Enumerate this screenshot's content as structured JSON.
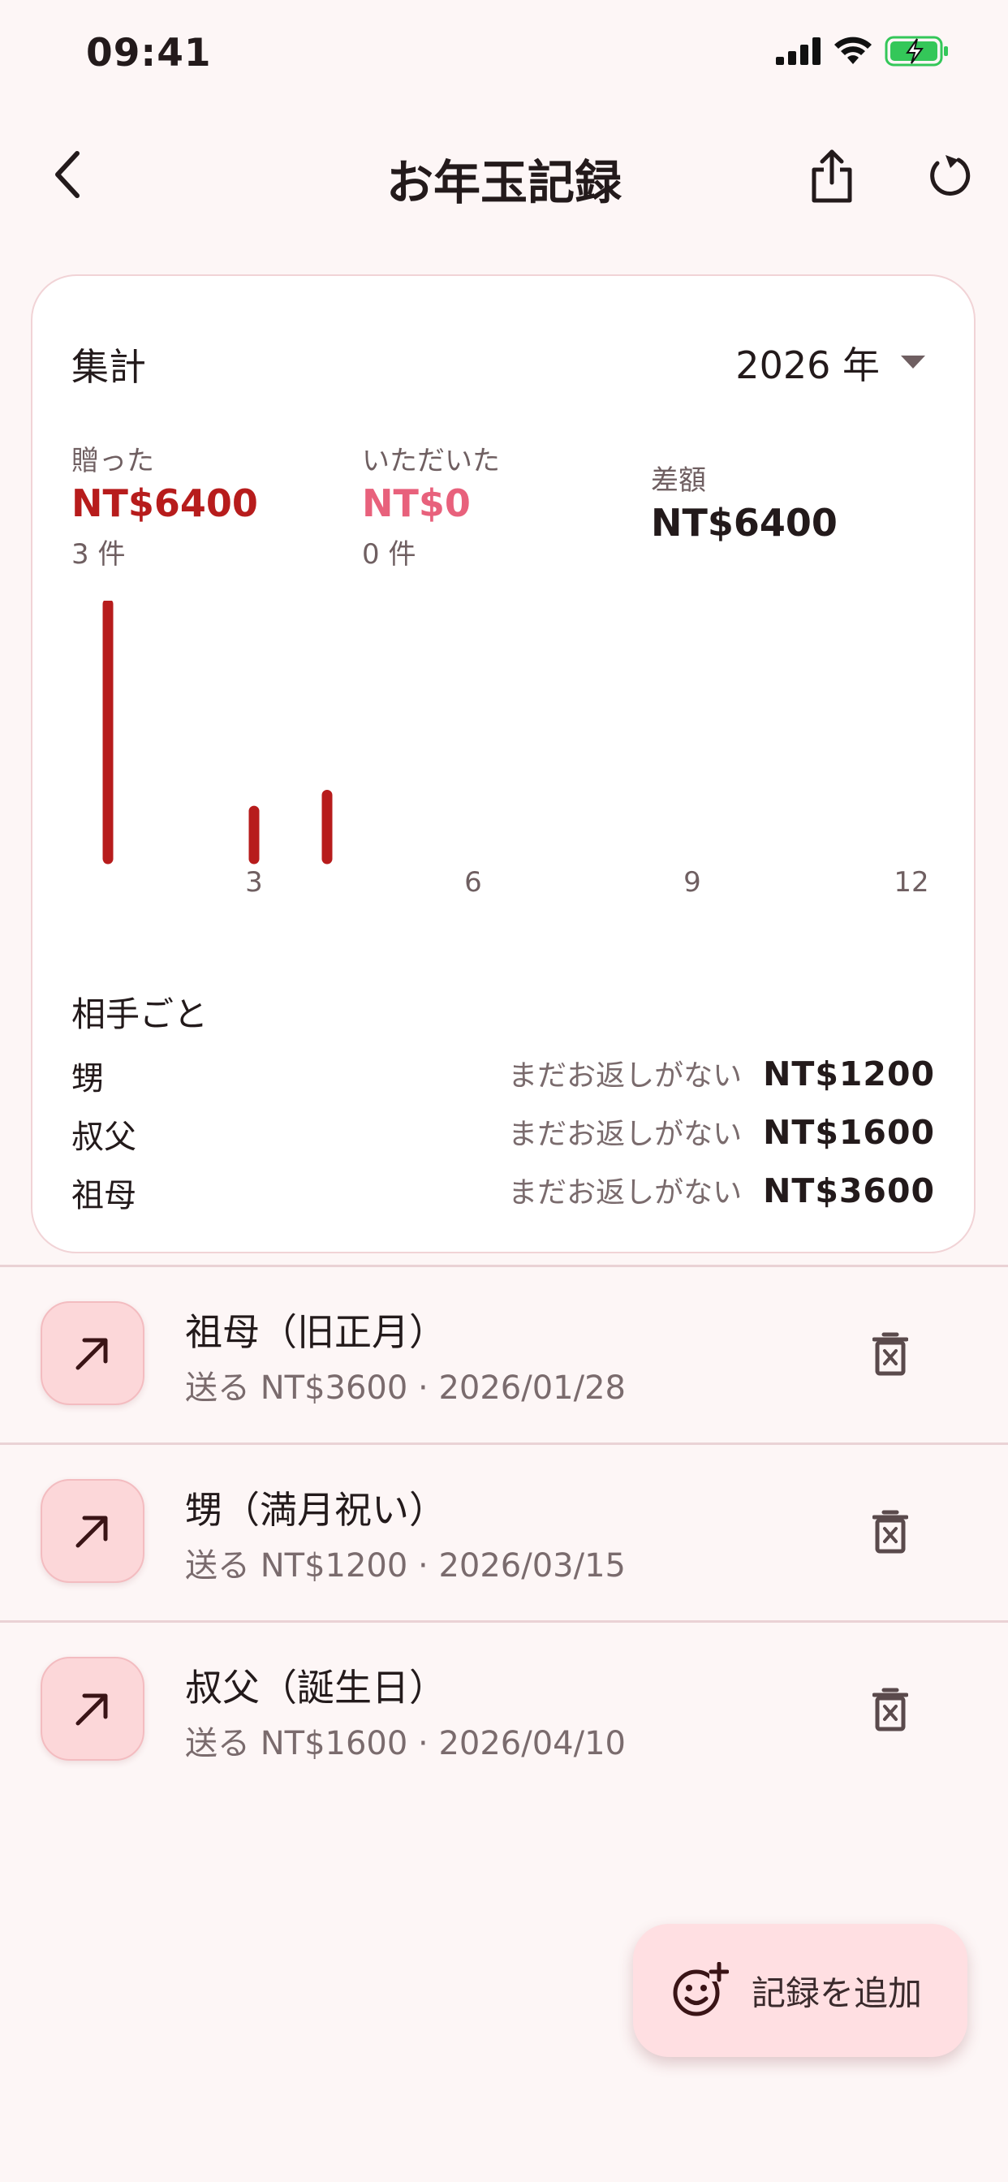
{
  "status_bar": {
    "time": "09:41"
  },
  "app_bar": {
    "title": "お年玉記録"
  },
  "summary": {
    "title": "集計",
    "year": "2026 年",
    "given": {
      "label": "贈った",
      "amount": "NT$6400",
      "count": "3 件"
    },
    "received": {
      "label": "いただいた",
      "amount": "NT$0",
      "count": "0 件"
    },
    "difference": {
      "label": "差額",
      "amount": "NT$6400"
    },
    "colors": {
      "given": "#b71c1c",
      "received": "#e8617c"
    }
  },
  "chart_data": {
    "type": "bar",
    "x": [
      1,
      3,
      4
    ],
    "values": [
      6400,
      1200,
      1600
    ],
    "xticks": [
      3,
      6,
      9,
      12
    ],
    "xlim": [
      0.5,
      12.5
    ],
    "ylim": [
      0,
      6400
    ],
    "color": "#b71c1c"
  },
  "per_person": {
    "title": "相手ごと",
    "rows": [
      {
        "name": "甥",
        "status": "まだお返しがない",
        "amount": "NT$1200"
      },
      {
        "name": "叔父",
        "status": "まだお返しがない",
        "amount": "NT$1600"
      },
      {
        "name": "祖母",
        "status": "まだお返しがない",
        "amount": "NT$3600"
      }
    ]
  },
  "records": [
    {
      "title": "祖母（旧正月）",
      "subtitle": "送る NT$3600 · 2026/01/28",
      "icon": "arrow-up-right-icon"
    },
    {
      "title": "甥（満月祝い）",
      "subtitle": "送る NT$1200 · 2026/03/15",
      "icon": "arrow-up-right-icon"
    },
    {
      "title": "叔父（誕生日）",
      "subtitle": "送る NT$1600 · 2026/04/10",
      "icon": "arrow-up-right-icon"
    }
  ],
  "fab": {
    "label": "記録を追加",
    "icon": "add-reaction-icon"
  }
}
